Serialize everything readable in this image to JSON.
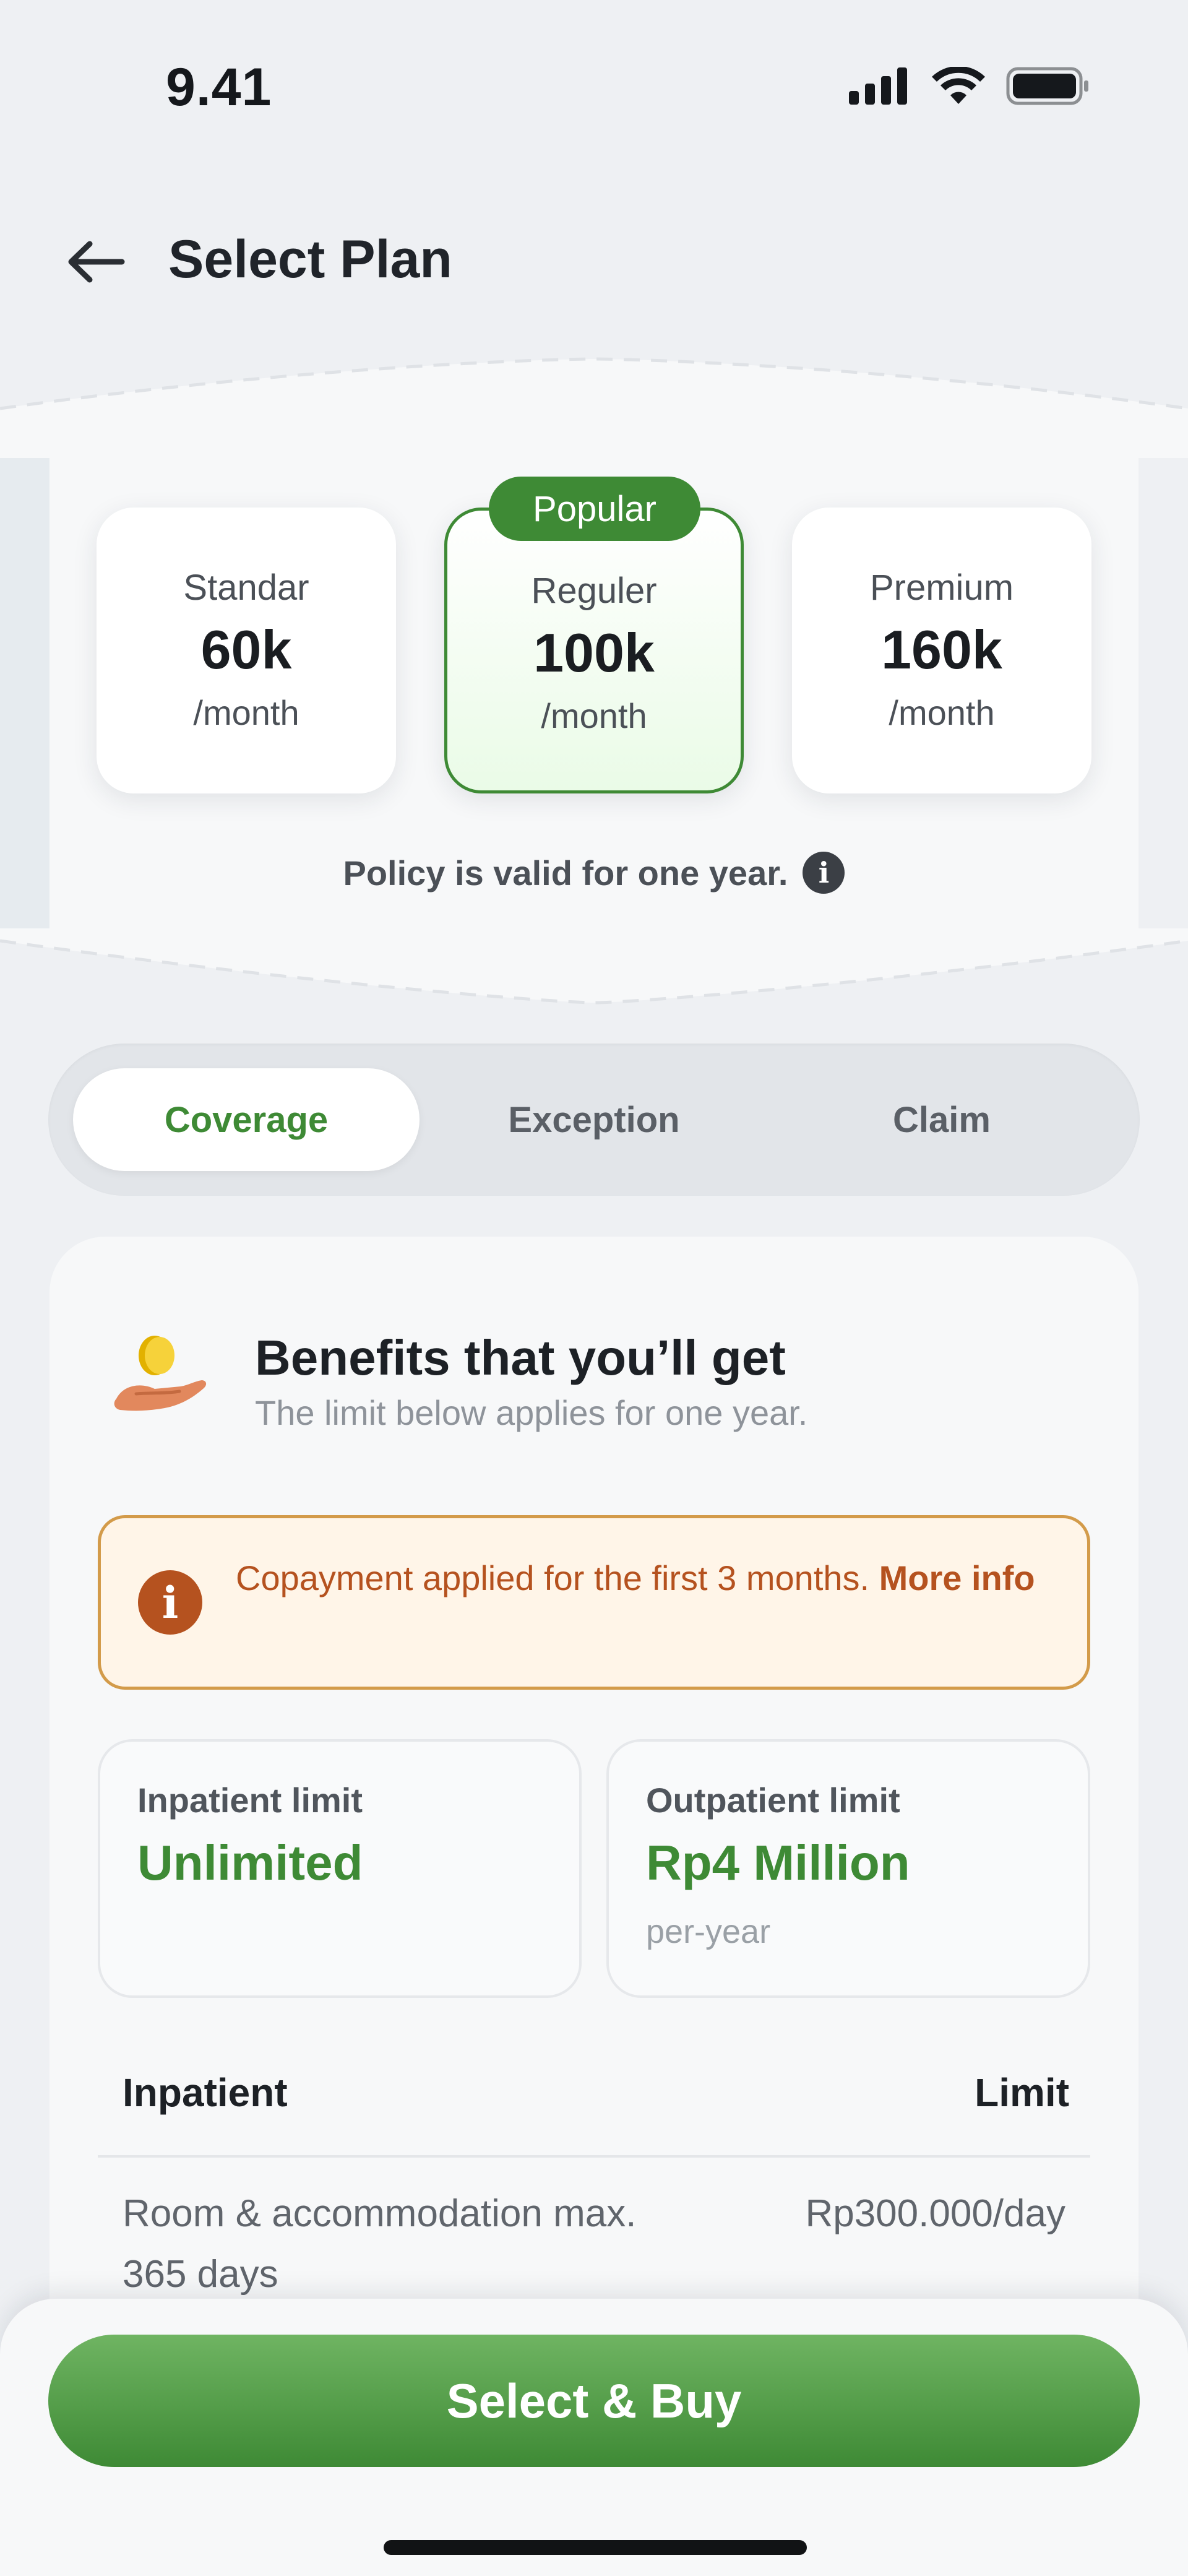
{
  "status_bar": {
    "time": "9.41",
    "icons": [
      "signal-icon",
      "wifi-icon",
      "battery-icon"
    ]
  },
  "header": {
    "back_icon": "arrow-left-icon",
    "title": "Select Plan"
  },
  "plans": {
    "badge": "Popular",
    "items": [
      {
        "name": "Standar",
        "price": "60k",
        "unit": "/month",
        "selected": false
      },
      {
        "name": "Reguler",
        "price": "100k",
        "unit": "/month",
        "selected": true
      },
      {
        "name": "Premium",
        "price": "160k",
        "unit": "/month",
        "selected": false
      }
    ],
    "policy_note": "Policy is valid for one year.",
    "info_icon": "info-icon"
  },
  "tabs": [
    {
      "label": "Coverage",
      "active": true
    },
    {
      "label": "Exception",
      "active": false
    },
    {
      "label": "Claim",
      "active": false
    }
  ],
  "benefits": {
    "icon": "hand-coin-icon",
    "title": "Benefits that you’ll get",
    "subtitle": "The limit below applies for one year.",
    "notice": {
      "icon": "info-icon",
      "text": "Copayment applied for the first 3 months.",
      "link": "More info"
    },
    "limits": [
      {
        "label": "Inpatient limit",
        "value": "Unlimited",
        "note": ""
      },
      {
        "label": "Outpatient limit",
        "value": "Rp4 Million",
        "note": "per-year"
      }
    ],
    "table": {
      "headers": [
        "Inpatient",
        "Limit"
      ],
      "rows": [
        {
          "item": "Room & accommodation max. 365 days",
          "limit": "Rp300.000/day"
        }
      ]
    }
  },
  "footer": {
    "button_label": "Select & Buy"
  },
  "colors": {
    "accent_green": "#3e8a35",
    "notice_orange": "#b5521f",
    "notice_bg": "#fff5e8",
    "background": "#eef0f3"
  }
}
